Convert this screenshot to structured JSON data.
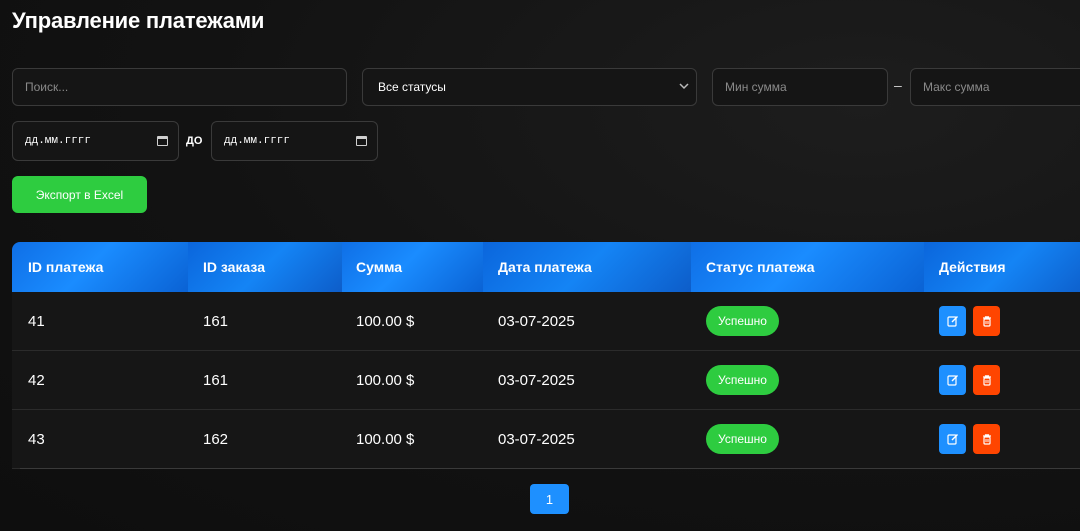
{
  "page": {
    "title": "Управление платежами"
  },
  "filters": {
    "search_placeholder": "Поиск...",
    "status_selected": "Все статусы",
    "min_placeholder": "Мин сумма",
    "range_dash": "–",
    "max_placeholder": "Макс сумма",
    "date_from": "дд.мм.гггг",
    "date_sep": "ДО",
    "date_to": "дд.мм.гггг"
  },
  "toolbar": {
    "export_label": "Экспорт в Excel"
  },
  "table": {
    "headers": [
      "ID платежа",
      "ID заказа",
      "Сумма",
      "Дата платежа",
      "Статус платежа",
      "Действия"
    ],
    "rows": [
      {
        "payment_id": "41",
        "order_id": "161",
        "amount": "100.00 $",
        "date": "03-07-2025",
        "status": "Успешно"
      },
      {
        "payment_id": "42",
        "order_id": "161",
        "amount": "100.00 $",
        "date": "03-07-2025",
        "status": "Успешно"
      },
      {
        "payment_id": "43",
        "order_id": "162",
        "amount": "100.00 $",
        "date": "03-07-2025",
        "status": "Успешно"
      }
    ]
  },
  "pagination": {
    "current": "1"
  },
  "colors": {
    "accent_blue": "#1e90ff",
    "success_green": "#2ecc40",
    "danger_orange": "#ff4500"
  },
  "icons": {
    "edit": "edit-icon",
    "delete": "trash-icon",
    "calendar": "calendar-icon",
    "chevron": "chevron-down-icon"
  }
}
